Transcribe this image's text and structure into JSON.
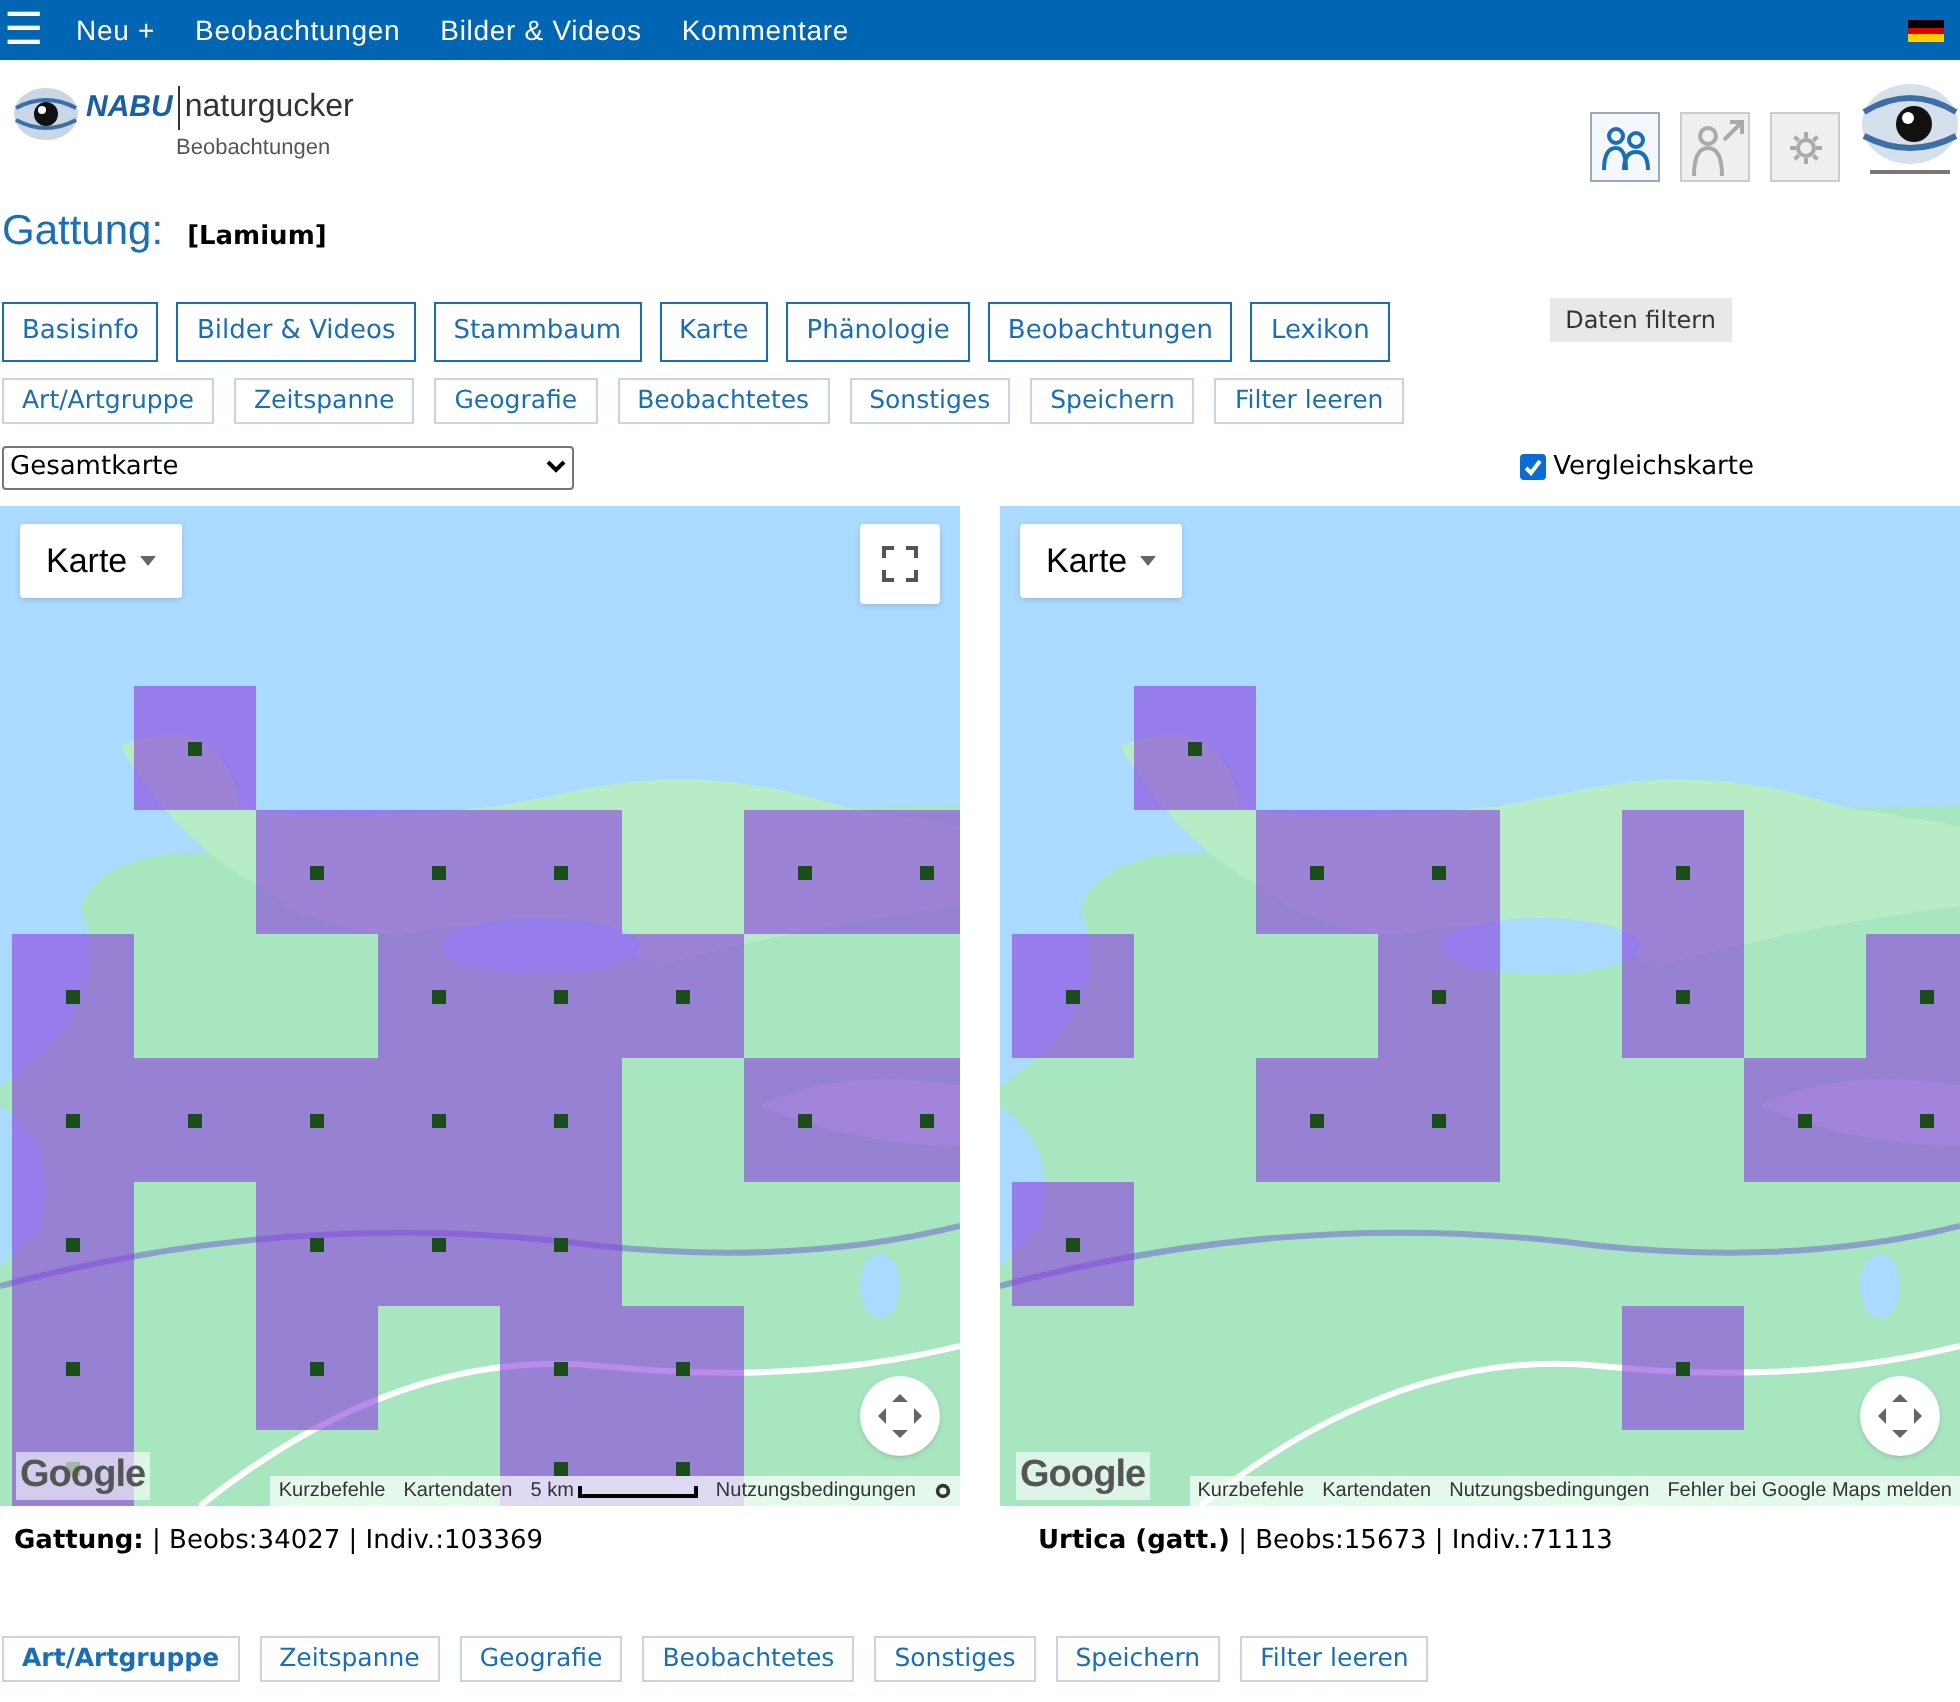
{
  "navbar": {
    "menu_icon": "☰",
    "items": [
      "Neu +",
      "Beobachtungen",
      "Bilder & Videos",
      "Kommentare"
    ]
  },
  "logo": {
    "brand": "NABU",
    "name": "naturgucker",
    "subtitle": "Beobachtungen"
  },
  "header_buttons": [
    {
      "kind": "people",
      "disabled": false
    },
    {
      "kind": "person-arrow",
      "disabled": true
    },
    {
      "kind": "gear",
      "disabled": true
    }
  ],
  "title": {
    "label": "Gattung:",
    "value": "[Lamium]"
  },
  "tabs": [
    {
      "label": "Basisinfo",
      "selected": false
    },
    {
      "label": "Bilder & Videos",
      "selected": false
    },
    {
      "label": "Stammbaum",
      "selected": false
    },
    {
      "label": "Karte",
      "selected": false
    },
    {
      "label": "Phänologie",
      "selected": false
    },
    {
      "label": "Beobachtungen",
      "selected": false
    },
    {
      "label": "Lexikon",
      "selected": false
    }
  ],
  "filter_button": "Daten filtern",
  "filters_top": [
    {
      "label": "Art/Artgruppe",
      "selected": false
    },
    {
      "label": "Zeitspanne",
      "selected": false
    },
    {
      "label": "Geografie",
      "selected": false
    },
    {
      "label": "Beobachtetes",
      "selected": false
    },
    {
      "label": "Sonstiges",
      "selected": false
    },
    {
      "label": "Speichern",
      "selected": false
    },
    {
      "label": "Filter leeren",
      "selected": false
    }
  ],
  "map_select": {
    "value": "Gesamtkarte"
  },
  "compare": {
    "label": "Vergleichskarte",
    "checked": true
  },
  "maps": [
    {
      "type_button": "Karte",
      "fullscreen": true,
      "grid": [
        [
          {
            "filled": false
          },
          {
            "filled": true
          },
          {
            "filled": false
          },
          {
            "filled": false
          },
          {
            "filled": false
          },
          {
            "filled": false
          },
          {
            "filled": false
          },
          {
            "filled": false
          }
        ],
        [
          {
            "filled": false
          },
          {
            "filled": false
          },
          {
            "filled": true
          },
          {
            "filled": true
          },
          {
            "filled": true
          },
          {
            "filled": false
          },
          {
            "filled": true
          },
          {
            "filled": true
          }
        ],
        [
          {
            "filled": true
          },
          {
            "filled": false
          },
          {
            "filled": false
          },
          {
            "filled": true
          },
          {
            "filled": true
          },
          {
            "filled": true
          },
          {
            "filled": false
          },
          {
            "filled": false
          }
        ],
        [
          {
            "filled": true
          },
          {
            "filled": true
          },
          {
            "filled": true
          },
          {
            "filled": true
          },
          {
            "filled": true
          },
          {
            "filled": false
          },
          {
            "filled": true
          },
          {
            "filled": true
          }
        ],
        [
          {
            "filled": true
          },
          {
            "filled": false
          },
          {
            "filled": true
          },
          {
            "filled": true
          },
          {
            "filled": true
          },
          {
            "filled": false
          },
          {
            "filled": false
          },
          {
            "filled": false
          }
        ],
        [
          {
            "filled": true
          },
          {
            "filled": false
          },
          {
            "filled": true
          },
          {
            "filled": false
          },
          {
            "filled": true
          },
          {
            "filled": true
          },
          {
            "filled": false
          },
          {
            "filled": false
          }
        ],
        [
          {
            "filled": true
          },
          {
            "filled": false
          },
          {
            "filled": false
          },
          {
            "filled": false
          },
          {
            "filled": true
          },
          {
            "filled": true
          },
          {
            "filled": false
          },
          {
            "filled": false
          }
        ]
      ],
      "attribution": {
        "logo": "Google",
        "links": [
          "Kurzbefehle",
          "Kartendaten"
        ],
        "scale": "5 km",
        "terms": "Nutzungsbedingungen"
      },
      "summary": {
        "taxon": "Gattung:",
        "text": " | Beobs:34027 | Indiv.:103369"
      }
    },
    {
      "type_button": "Karte",
      "grid": [
        [
          {
            "filled": false
          },
          {
            "filled": true
          },
          {
            "filled": false
          },
          {
            "filled": false
          },
          {
            "filled": false
          },
          {
            "filled": false
          },
          {
            "filled": false
          },
          {
            "filled": false
          }
        ],
        [
          {
            "filled": false
          },
          {
            "filled": false
          },
          {
            "filled": true
          },
          {
            "filled": true
          },
          {
            "filled": false
          },
          {
            "filled": true
          },
          {
            "filled": false
          },
          {
            "filled": false
          }
        ],
        [
          {
            "filled": true
          },
          {
            "filled": false
          },
          {
            "filled": false
          },
          {
            "filled": true
          },
          {
            "filled": false
          },
          {
            "filled": true
          },
          {
            "filled": false
          },
          {
            "filled": true
          }
        ],
        [
          {
            "filled": false
          },
          {
            "filled": false
          },
          {
            "filled": true
          },
          {
            "filled": true
          },
          {
            "filled": false
          },
          {
            "filled": false
          },
          {
            "filled": true
          },
          {
            "filled": true
          }
        ],
        [
          {
            "filled": true
          },
          {
            "filled": false
          },
          {
            "filled": false
          },
          {
            "filled": false
          },
          {
            "filled": false
          },
          {
            "filled": false
          },
          {
            "filled": false
          },
          {
            "filled": false
          }
        ],
        [
          {
            "filled": false
          },
          {
            "filled": false
          },
          {
            "filled": false
          },
          {
            "filled": false
          },
          {
            "filled": false
          },
          {
            "filled": true
          },
          {
            "filled": false
          },
          {
            "filled": false
          }
        ]
      ],
      "attribution": {
        "logo": "Google",
        "links": [
          "Kurzbefehle",
          "Kartendaten",
          "Nutzungsbedingungen",
          "Fehler bei Google Maps melden"
        ]
      },
      "summary": {
        "taxon": "Urtica (gatt.)",
        "text": " | Beobs:15673 | Indiv.:71113"
      }
    }
  ],
  "filters_bottom": [
    {
      "label": "Art/Artgruppe",
      "selected": true
    },
    {
      "label": "Zeitspanne",
      "selected": false
    },
    {
      "label": "Geografie",
      "selected": false
    },
    {
      "label": "Beobachtetes",
      "selected": false
    },
    {
      "label": "Sonstiges",
      "selected": false
    },
    {
      "label": "Speichern",
      "selected": false
    },
    {
      "label": "Filter leeren",
      "selected": false
    }
  ]
}
